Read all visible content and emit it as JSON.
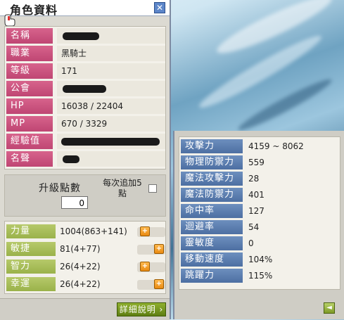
{
  "window": {
    "title": "角色資料",
    "close_glyph": "✕"
  },
  "info": {
    "rows": [
      {
        "label": "名稱",
        "value": ""
      },
      {
        "label": "職業",
        "value": "黑騎士"
      },
      {
        "label": "等級",
        "value": "171"
      },
      {
        "label": "公會",
        "value": ""
      },
      {
        "label": "HP",
        "value": "16038 / 22404"
      },
      {
        "label": "MP",
        "value": "670 / 3329"
      },
      {
        "label": "經驗值",
        "value": ""
      },
      {
        "label": "名聲",
        "value": ""
      }
    ]
  },
  "ability_points": {
    "label": "升級點數",
    "value": "0",
    "auto_add_label": "每次追加5點",
    "auto_add_checked": false
  },
  "stats": [
    {
      "label": "力量",
      "value": "1004(863+141)"
    },
    {
      "label": "敏捷",
      "value": "81(4+77)"
    },
    {
      "label": "智力",
      "value": "26(4+22)"
    },
    {
      "label": "幸運",
      "value": "26(4+22)"
    }
  ],
  "buttons": {
    "plus": "+",
    "detail": "詳細說明 ›",
    "back": "◄"
  },
  "details": [
    {
      "label": "攻擊力",
      "value": "4159 ~ 8062"
    },
    {
      "label": "物理防禦力",
      "value": "559"
    },
    {
      "label": "魔法攻擊力",
      "value": "28"
    },
    {
      "label": "魔法防禦力",
      "value": "401"
    },
    {
      "label": "命中率",
      "value": "127"
    },
    {
      "label": "迴避率",
      "value": "54"
    },
    {
      "label": "靈敏度",
      "value": "0"
    },
    {
      "label": "移動速度",
      "value": "104%"
    },
    {
      "label": "跳躍力",
      "value": "115%"
    }
  ],
  "icons": [
    "close-icon",
    "mouse-cursor-icon",
    "plus-icon",
    "arrow-left-icon"
  ],
  "colors": {
    "info_label": "#c8507c",
    "stat_label": "#a6bc55",
    "detail_label": "#5a7cb0",
    "plus_button": "#f0982a"
  }
}
